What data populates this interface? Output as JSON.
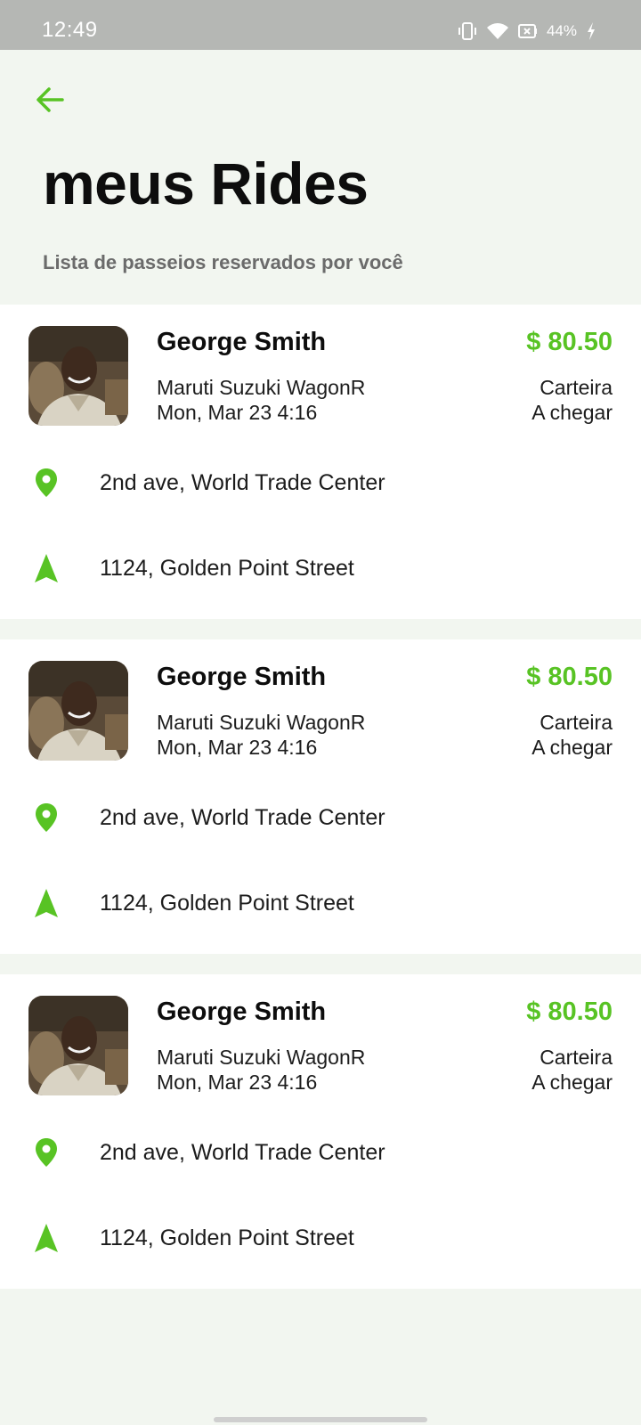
{
  "status_bar": {
    "time": "12:49",
    "battery": "44%",
    "icons": [
      "vibrate-icon",
      "wifi-icon",
      "battery-icon",
      "charging-icon"
    ]
  },
  "colors": {
    "accent": "#58c324",
    "background": "#f2f6f0",
    "card": "#ffffff",
    "status_bar": "#b5b7b4"
  },
  "header": {
    "back_icon": "arrow-left-icon",
    "title": "meus Rides",
    "subtitle": "Lista de passeios reservados por você"
  },
  "rides": [
    {
      "driver_name": "George Smith",
      "fare": "$ 80.50",
      "car_model": "Maruti Suzuki WagonR",
      "datetime": "Mon, Mar 23 4:16",
      "payment": "Carteira",
      "status": "A chegar",
      "pickup": "2nd ave, World Trade Center",
      "dropoff": "1124, Golden Point Street"
    },
    {
      "driver_name": "George Smith",
      "fare": "$ 80.50",
      "car_model": "Maruti Suzuki WagonR",
      "datetime": "Mon, Mar 23 4:16",
      "payment": "Carteira",
      "status": "A chegar",
      "pickup": "2nd ave, World Trade Center",
      "dropoff": "1124, Golden Point Street"
    },
    {
      "driver_name": "George Smith",
      "fare": "$ 80.50",
      "car_model": "Maruti Suzuki WagonR",
      "datetime": "Mon, Mar 23 4:16",
      "payment": "Carteira",
      "status": "A chegar",
      "pickup": "2nd ave, World Trade Center",
      "dropoff": "1124, Golden Point Street"
    }
  ]
}
